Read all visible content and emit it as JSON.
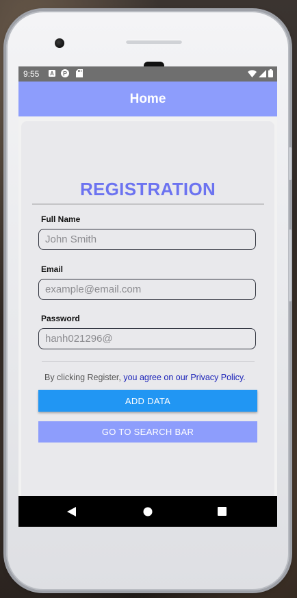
{
  "status_bar": {
    "time": "9:55",
    "left_icons": [
      "a-notification-icon",
      "p-notification-icon",
      "sd-card-icon"
    ],
    "right_icons": [
      "wifi-icon",
      "signal-icon",
      "battery-icon"
    ]
  },
  "app_bar": {
    "title": "Home"
  },
  "form": {
    "title": "REGISTRATION",
    "fields": [
      {
        "label": "Full Name",
        "placeholder": "John Smith",
        "value": ""
      },
      {
        "label": "Email",
        "placeholder": "example@email.com",
        "value": ""
      },
      {
        "label": "Password",
        "placeholder": "hanh021296@",
        "value": ""
      }
    ],
    "terms_prefix": "By clicking Register,",
    "terms_link": " you agree on our Privacy Policy."
  },
  "buttons": {
    "add_data": "ADD DATA",
    "go_to_search": "GO TO SEARCH BAR"
  },
  "navigation": {
    "icons": [
      "back-icon",
      "home-icon",
      "recents-icon"
    ]
  },
  "colors": {
    "app_bar": "#8d9dfc",
    "title": "#6c73f0",
    "add_button": "#2196f3",
    "link": "#1a22b8"
  }
}
